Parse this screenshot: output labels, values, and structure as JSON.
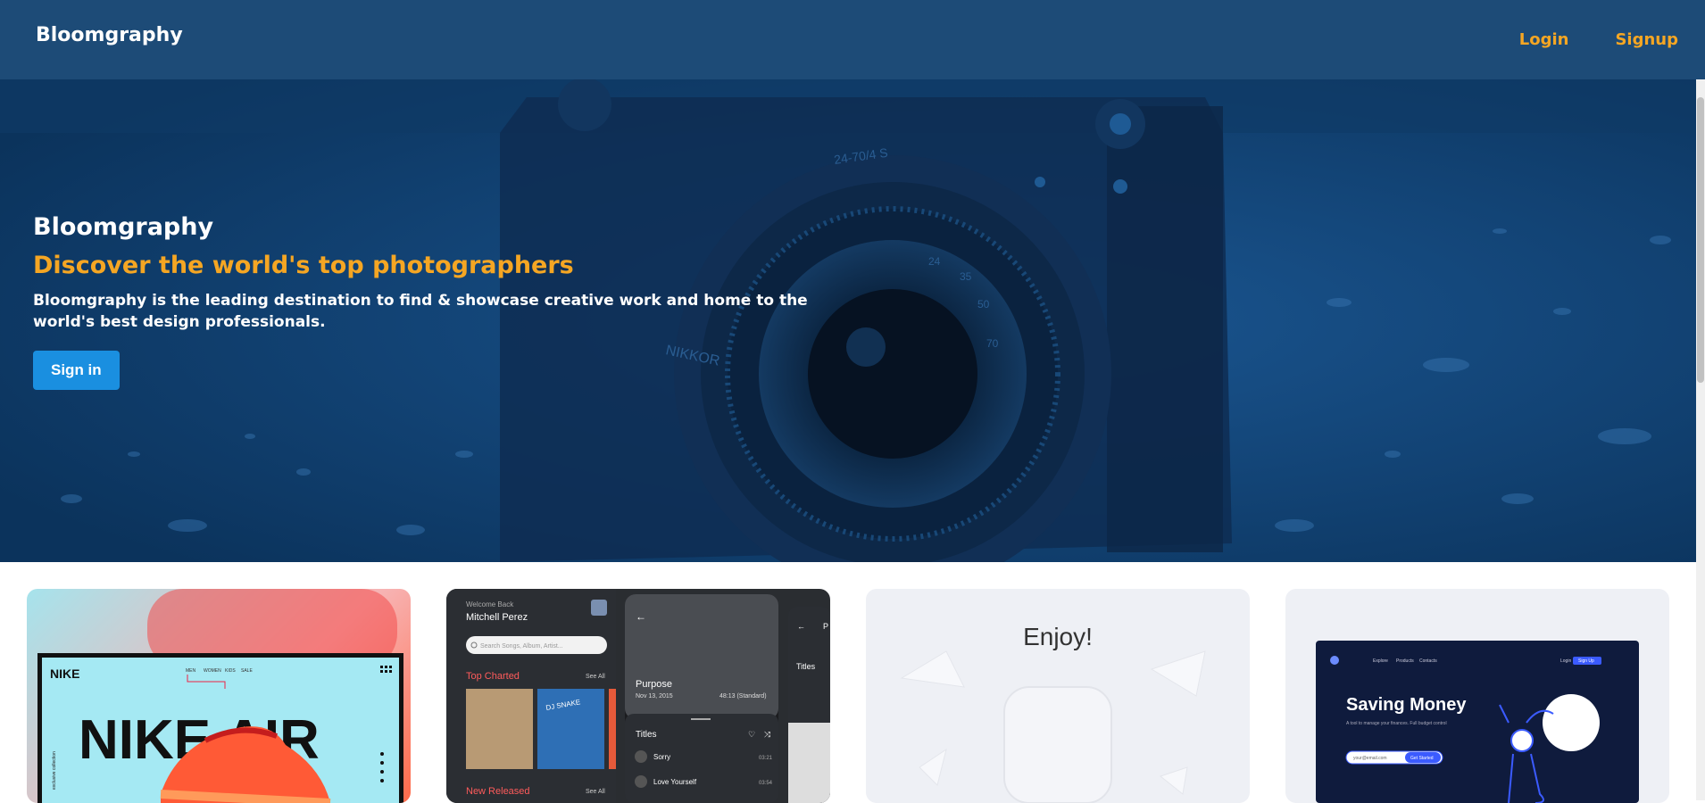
{
  "nav": {
    "brand": "Bloomgraphy",
    "login": "Login",
    "signup": "Signup"
  },
  "hero": {
    "title": "Bloomgraphy",
    "subtitle": "Discover the world's top photographers",
    "description": "Bloomgraphy is the leading destination to find & showcase creative work and home to the world's best design professionals.",
    "cta": "Sign in",
    "lens_text": "NIKKOR",
    "lens_marks": [
      "24-70/4 S",
      "24",
      "35",
      "50",
      "70"
    ]
  },
  "cards": [
    {
      "brand": "NIKE",
      "headline": "NIKE AIR",
      "menu": [
        "MEN",
        "WOMEN",
        "KIDS",
        "SALE"
      ],
      "side_text": "exclusive collection"
    },
    {
      "welcome": "Welcome Back",
      "user": "Mitchell Perez",
      "search_placeholder": "Search Songs, Album, Artist...",
      "top_charted": "Top Charted",
      "see_all": "See All",
      "album_label": "DJ SNAKE",
      "new_released": "New Released",
      "album_title": "Purpose",
      "album_date": "Nov 13, 2015",
      "album_length": "48:13 (Standard)",
      "titles": "Titles",
      "tracks": [
        {
          "name": "Sorry",
          "time": "03:21"
        },
        {
          "name": "Love Yourself",
          "time": "03:54"
        }
      ],
      "side_titles": "Titles",
      "side_letter": "P"
    },
    {
      "headline": "Enjoy!"
    },
    {
      "nav": [
        "Explore",
        "Products",
        "Contacts"
      ],
      "login": "Login",
      "signup": "Sign Up",
      "headline": "Saving Money",
      "text": "A tool to manage your finances. Full budget control",
      "email_placeholder": "your@email.com",
      "button": "Get Started"
    }
  ],
  "colors": {
    "nav_bg": "#1d4b77",
    "accent": "#f5a623",
    "button": "#1a8fe0"
  }
}
